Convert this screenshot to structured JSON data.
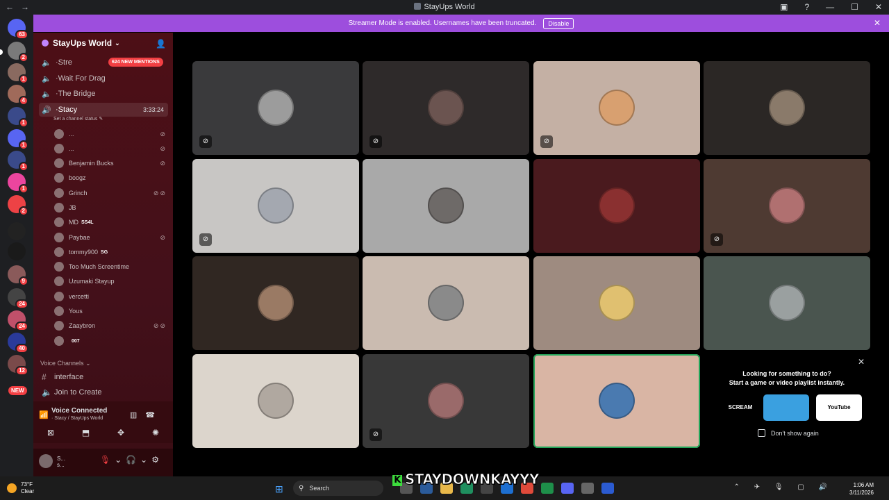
{
  "window": {
    "title": "StayUps World"
  },
  "banner": {
    "text": "Streamer Mode is enabled. Usernames have been truncated.",
    "disable_label": "Disable"
  },
  "rail": {
    "badges": [
      "63",
      "2",
      "1",
      "4",
      "1",
      "1",
      "1",
      "1",
      "2",
      "9",
      "24",
      "24",
      "40",
      "12"
    ],
    "new_label": "NEW"
  },
  "guild": {
    "name": "StayUps World"
  },
  "channels": {
    "items": [
      {
        "name": "Stre"
      },
      {
        "name": "Wait For Drag"
      },
      {
        "name": "The Bridge"
      },
      {
        "name": "Stacy",
        "timer": "3:33:24"
      }
    ],
    "mentions": "624 NEW MENTIONS",
    "status_hint": "Set a channel status"
  },
  "members": [
    {
      "name": "...",
      "icons": "⊘"
    },
    {
      "name": "...",
      "icons": "⊘"
    },
    {
      "name": "Benjamin Bucks",
      "icons": "⊘"
    },
    {
      "name": "boogz",
      "icons": ""
    },
    {
      "name": "Grinch",
      "icons": "⊘⊘"
    },
    {
      "name": "JB",
      "icons": ""
    },
    {
      "name": "MD",
      "tag": "SS4L",
      "icons": ""
    },
    {
      "name": "Paybae",
      "icons": "⊘"
    },
    {
      "name": "tommy900",
      "tag": "SG",
      "icons": ""
    },
    {
      "name": "Too Much Screentime",
      "icons": ""
    },
    {
      "name": "Uzumaki Stayup",
      "icons": ""
    },
    {
      "name": "vercetti",
      "icons": ""
    },
    {
      "name": "Yous",
      "icons": ""
    },
    {
      "name": "Zaaybron",
      "icons": "⊘⊘"
    },
    {
      "name": "",
      "tag": "007",
      "icons": ""
    }
  ],
  "voice_section": {
    "label": "Voice Channels",
    "items": [
      {
        "name": "interface",
        "kind": "text"
      },
      {
        "name": "Join to Create",
        "kind": "voice"
      }
    ]
  },
  "voice_panel": {
    "status": "Voice Connected",
    "location": "Stacy / StayUps World"
  },
  "user_panel": {
    "name": "S...",
    "sub": "s..."
  },
  "tiles": [
    {
      "bg": "#3a3a3c",
      "face": "#9c9c9c",
      "muted": true
    },
    {
      "bg": "#2e2a2a",
      "face": "#6b5450",
      "muted": true
    },
    {
      "bg": "#c4b0a4",
      "face": "#d8a070",
      "muted": true
    },
    {
      "bg": "#2b2725",
      "face": "#8a7a6a",
      "muted": false
    },
    {
      "bg": "#c8c6c4",
      "face": "#a4a8b0",
      "muted": true
    },
    {
      "bg": "#a9a9a9",
      "face": "#6e6a68",
      "muted": false
    },
    {
      "bg": "#4a1a1e",
      "face": "#8a3030",
      "muted": false
    },
    {
      "bg": "#4e3a32",
      "face": "#b07070",
      "muted": true
    },
    {
      "bg": "#302722",
      "face": "#9a7a64",
      "muted": false
    },
    {
      "bg": "#cabbb0",
      "face": "#8a8a8a",
      "muted": false
    },
    {
      "bg": "#9e8b80",
      "face": "#e0c070",
      "muted": false
    },
    {
      "bg": "#4a554f",
      "face": "#9aa0a0",
      "muted": false
    },
    {
      "bg": "#dcd5cc",
      "face": "#b0a8a0",
      "muted": false
    },
    {
      "bg": "#383838",
      "face": "#9a6a6a",
      "muted": true
    },
    {
      "bg": "#d9b5a4",
      "face": "#4a7ab0",
      "muted": false,
      "speaking": true
    }
  ],
  "activity": {
    "line1": "Looking for something to do?",
    "line2": "Start a game or video playlist instantly.",
    "cards": [
      {
        "label": "SCREAM",
        "bg": "#5a1a10"
      },
      {
        "label": "",
        "bg": "#3aa0e0"
      },
      {
        "label": "YouTube",
        "bg": "#ffffff"
      }
    ],
    "dont_show": "Don't show again"
  },
  "taskbar": {
    "temp": "73°F",
    "cond": "Clear",
    "search": "Search",
    "time": "1:06 AM",
    "date": "3/11/2026"
  },
  "overlay": {
    "text": "STAYDOWNKAYYY"
  }
}
